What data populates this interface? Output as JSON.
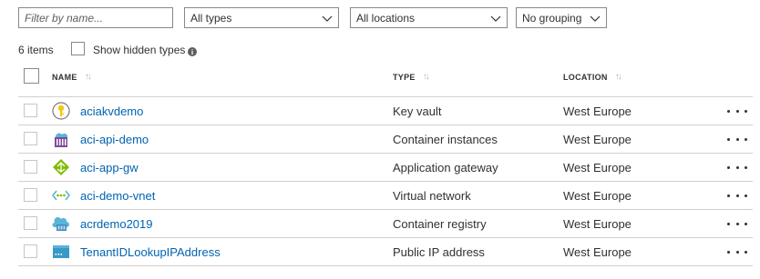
{
  "filters": {
    "name_placeholder": "Filter by name...",
    "types_value": "All types",
    "locations_value": "All locations",
    "grouping_value": "No grouping"
  },
  "summary": {
    "items_count": "6 items",
    "show_hidden_label": "Show hidden types"
  },
  "table": {
    "columns": [
      "NAME",
      "TYPE",
      "LOCATION"
    ],
    "rows": [
      {
        "name": "aciakvdemo",
        "type": "Key vault",
        "location": "West Europe",
        "icon": "key-vault-icon"
      },
      {
        "name": "aci-api-demo",
        "type": "Container instances",
        "location": "West Europe",
        "icon": "container-instances-icon"
      },
      {
        "name": "aci-app-gw",
        "type": "Application gateway",
        "location": "West Europe",
        "icon": "application-gateway-icon"
      },
      {
        "name": "aci-demo-vnet",
        "type": "Virtual network",
        "location": "West Europe",
        "icon": "virtual-network-icon"
      },
      {
        "name": "acrdemo2019",
        "type": "Container registry",
        "location": "West Europe",
        "icon": "container-registry-icon"
      },
      {
        "name": "TenantIDLookupIPAddress",
        "type": "Public IP address",
        "location": "West Europe",
        "icon": "public-ip-address-icon"
      }
    ]
  },
  "colors": {
    "link": "#0063b1",
    "border": "#8a8886",
    "row_divider": "#d2d0ce"
  }
}
